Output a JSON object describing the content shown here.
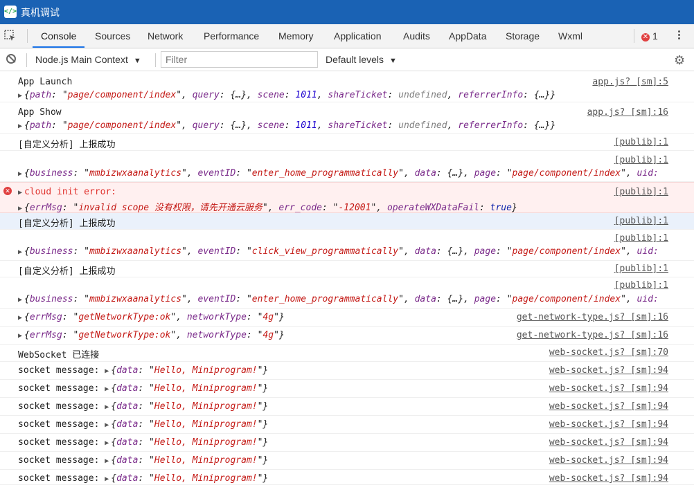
{
  "app": {
    "title": "真机调试"
  },
  "tabs": [
    "Console",
    "Sources",
    "Network",
    "Performance",
    "Memory",
    "Application",
    "Audits",
    "AppData",
    "Storage",
    "Wxml"
  ],
  "error_count": "1",
  "toolbar": {
    "context": "Node.js Main Context",
    "filter_placeholder": "Filter",
    "levels": "Default levels"
  },
  "obj": {
    "launch": [
      "path",
      "page/component/index",
      "query",
      "{…}",
      "scene",
      "1011",
      "shareTicket",
      "undefined",
      "referrerInfo",
      "{…}"
    ],
    "biz_home": [
      "business",
      "mmbizwxaanalytics",
      "eventID",
      "enter_home_programmatically",
      "data",
      "{…}",
      "page",
      "page/component/index",
      "uid:"
    ],
    "biz_click": [
      "business",
      "mmbizwxaanalytics",
      "eventID",
      "click_view_programmatically",
      "data",
      "{…}",
      "page",
      "page/component/index",
      "uid:"
    ],
    "err": [
      "errMsg",
      "invalid scope 没有权限，请先开通云服务",
      "err_code",
      "-12001",
      "operateWXDataFail",
      "true"
    ],
    "net": [
      "errMsg",
      "getNetworkType:ok",
      "networkType",
      "4g"
    ],
    "sock": [
      "data",
      "Hello, Miniprogram!"
    ]
  },
  "logs": {
    "app_launch": "App Launch",
    "app_show": "App Show",
    "custom_ok": "[自定义分析] 上报成功",
    "cloud_err": "cloud init error:",
    "websocket": "WebSocket 已连接",
    "socket_msg": "socket message:"
  },
  "sources": {
    "app5": "app.js? [sm]:5",
    "app16": "app.js? [sm]:16",
    "publib": "[publib]:1",
    "net": "get-network-type.js? [sm]:16",
    "ws70": "web-socket.js? [sm]:70",
    "ws94": "web-socket.js? [sm]:94"
  },
  "colors": {
    "titlebar": "#1a62b4",
    "error_bg": "#fff0f0",
    "highlight_bg": "#eaf1fb",
    "string": "#c41a16",
    "number": "#1c00cf"
  },
  "icons": [
    "devtools-logo-icon",
    "inspect-icon",
    "error-icon",
    "more-icon",
    "clear-console-icon",
    "caret-down-icon",
    "gear-icon",
    "expand-triangle-icon"
  ]
}
